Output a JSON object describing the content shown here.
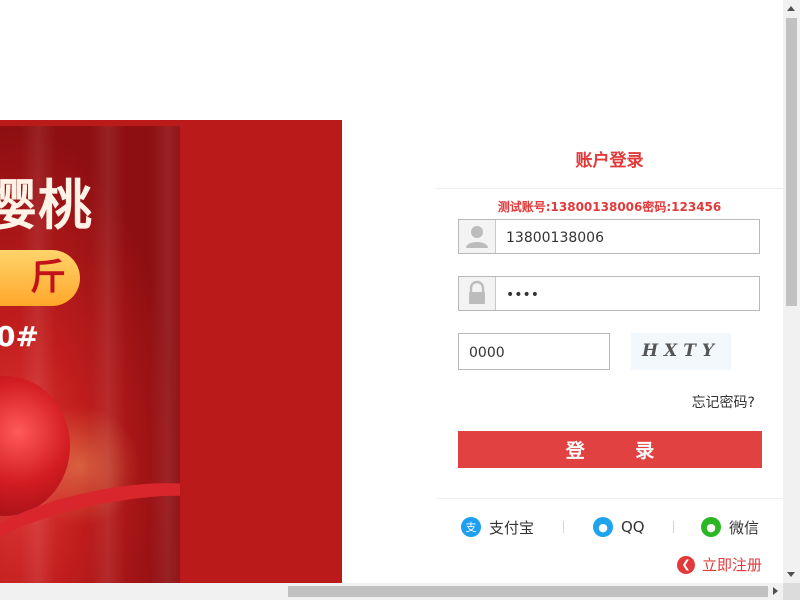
{
  "banner": {
    "title": "樱桃",
    "price": "斤",
    "promo_code": "0#"
  },
  "login": {
    "title": "账户登录",
    "hint": "测试账号:13800138006密码:123456",
    "username_value": "13800138006",
    "password_value": "1234",
    "code_value": "0000",
    "captcha_text": "HXTY",
    "forgot_label": "忘记密码?",
    "login_button": "登 录"
  },
  "social": [
    {
      "label": "支付宝",
      "icon": "alipay-icon",
      "glyph": "支",
      "color": "#1e9ef0"
    },
    {
      "label": "QQ",
      "icon": "qq-icon",
      "glyph": "●",
      "color": "#1ea3ee"
    },
    {
      "label": "微信",
      "icon": "wechat-icon",
      "glyph": "●",
      "color": "#2bb723"
    }
  ],
  "register": {
    "label": "立即注册",
    "icon": "chevron-left-icon"
  },
  "colors": {
    "accent": "#e23a3a",
    "banner_red": "#bb1a1a"
  }
}
